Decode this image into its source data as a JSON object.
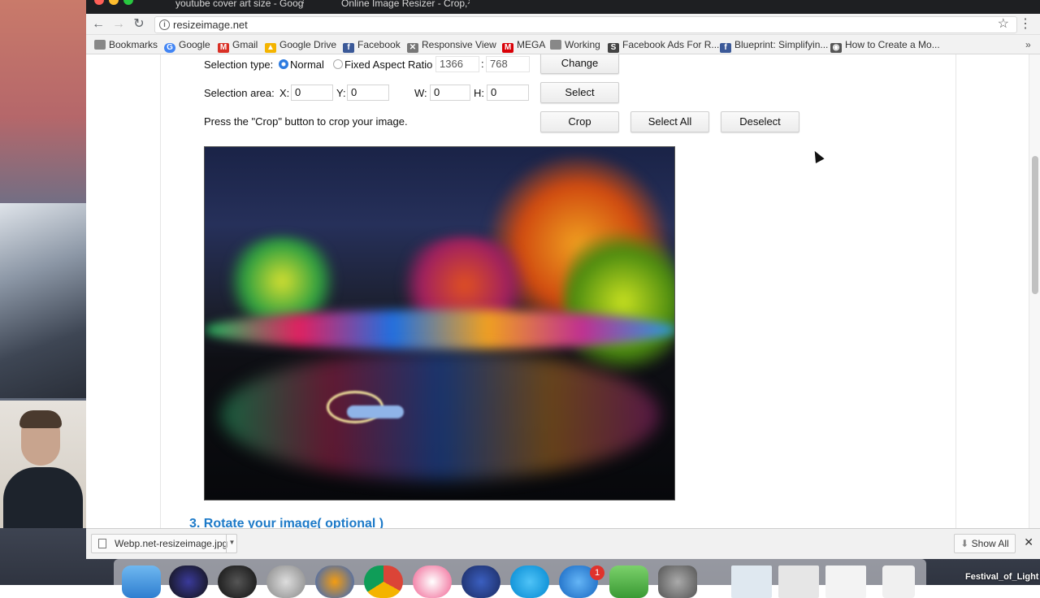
{
  "tabs": [
    {
      "label": "youtube cover art size - Googl"
    },
    {
      "label": "Online Image Resizer - Crop, R"
    }
  ],
  "address": {
    "url": "resizeimage.net"
  },
  "bookmarks": [
    {
      "label": "Bookmarks"
    },
    {
      "label": "Google"
    },
    {
      "label": "Gmail"
    },
    {
      "label": "Google Drive"
    },
    {
      "label": "Facebook"
    },
    {
      "label": "Responsive View"
    },
    {
      "label": "MEGA"
    },
    {
      "label": "Working"
    },
    {
      "label": "Facebook Ads For R..."
    },
    {
      "label": "Blueprint: Simplifyin..."
    },
    {
      "label": "How to Create a Mo..."
    }
  ],
  "form": {
    "selection_type_label": "Selection type:",
    "normal_label": "Normal",
    "fixed_label": "Fixed Aspect Ratio",
    "ratio_w": "1366",
    "ratio_sep": ":",
    "ratio_h": "768",
    "change_btn": "Change",
    "selection_area_label": "Selection area:",
    "x_label": "X:",
    "x_val": "0",
    "y_label": "Y:",
    "y_val": "0",
    "w_label": "W:",
    "w_val": "0",
    "h_label": "H:",
    "h_val": "0",
    "select_btn": "Select",
    "crop_hint": "Press the \"Crop\" button to crop your image.",
    "crop_btn": "Crop",
    "select_all_btn": "Select All",
    "deselect_btn": "Deselect"
  },
  "section3": "3. Rotate your image( optional )",
  "downloads": {
    "file": "Webp.net-resizeimage.jpg",
    "show_all": "Show All"
  },
  "dock": {
    "badge": "1",
    "desktop_label": "Festival_of_Light"
  },
  "colors": {
    "link_blue": "#1d7ac8",
    "radio_blue": "#2d7be0"
  }
}
